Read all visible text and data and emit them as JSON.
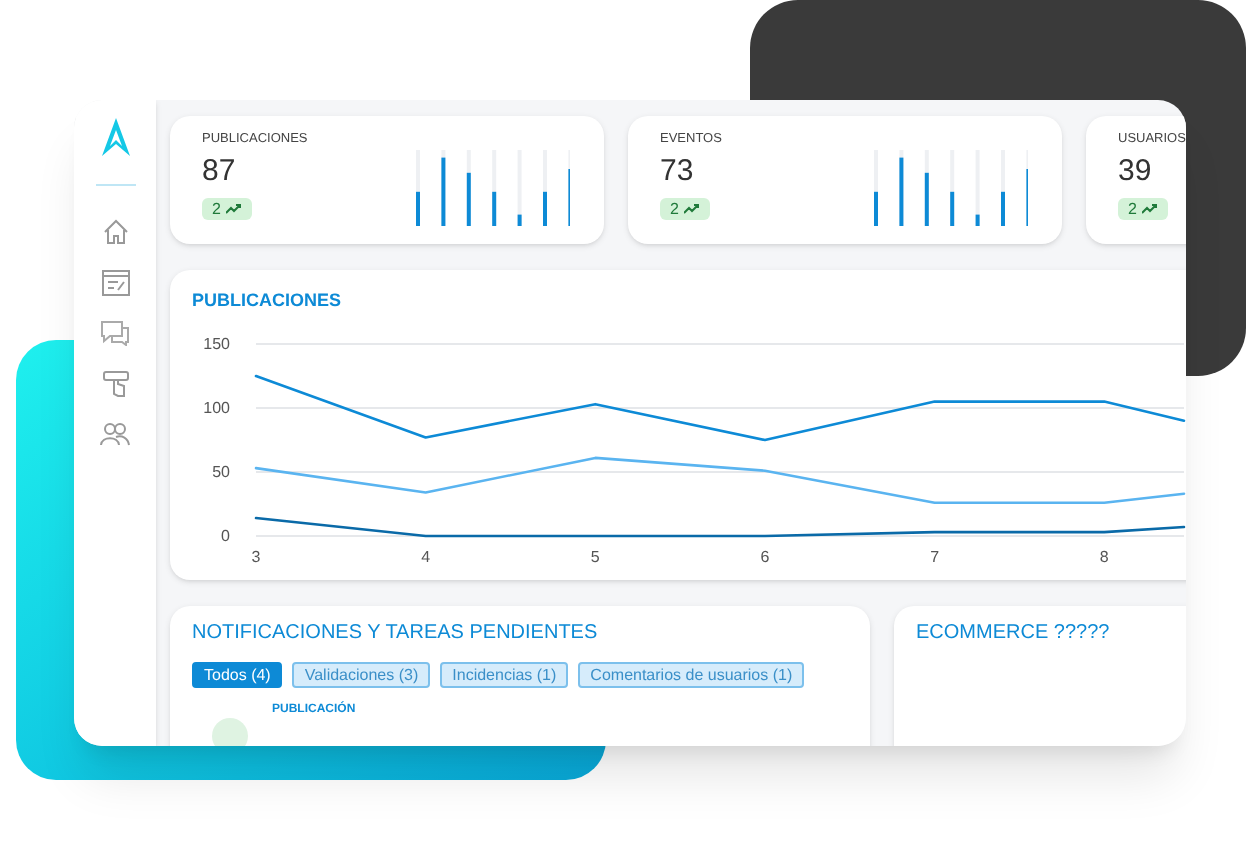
{
  "stats": [
    {
      "label": "PUBLICACIONES",
      "value": "87",
      "badge": "2"
    },
    {
      "label": "EVENTOS",
      "value": "73",
      "badge": "2"
    },
    {
      "label": "USUARIOS",
      "value": "39",
      "badge": "2"
    }
  ],
  "chart": {
    "title": "PUBLICACIONES",
    "chart_data": {
      "type": "line",
      "x": [
        3,
        4,
        5,
        6,
        7,
        8,
        8.47
      ],
      "xlim": [
        3,
        8.47
      ],
      "ylim": [
        0,
        150
      ],
      "xticks": [
        3,
        4,
        5,
        6,
        7,
        8
      ],
      "yticks": [
        0,
        50,
        100,
        150
      ],
      "series": [
        {
          "color": "#0d8ad6",
          "values": [
            125,
            77,
            103,
            75,
            105,
            105,
            90
          ]
        },
        {
          "color": "#5ab4f0",
          "values": [
            53,
            34,
            61,
            51,
            26,
            26,
            33
          ]
        },
        {
          "color": "#0a6aa8",
          "values": [
            14,
            0,
            0,
            0,
            3,
            3,
            7
          ]
        }
      ]
    }
  },
  "notifications": {
    "title": "NOTIFICACIONES Y TAREAS PENDIENTES",
    "filters": [
      {
        "label": "Todos (4)",
        "selected": true
      },
      {
        "label": "Validaciones (3)",
        "selected": false
      },
      {
        "label": "Incidencias (1)",
        "selected": false
      },
      {
        "label": "Comentarios de usuarios (1)",
        "selected": false
      }
    ],
    "items": [
      {
        "category": "PUBLICACIÓN"
      }
    ]
  },
  "ecommerce": {
    "title": "ECOMMERCE ?????"
  }
}
